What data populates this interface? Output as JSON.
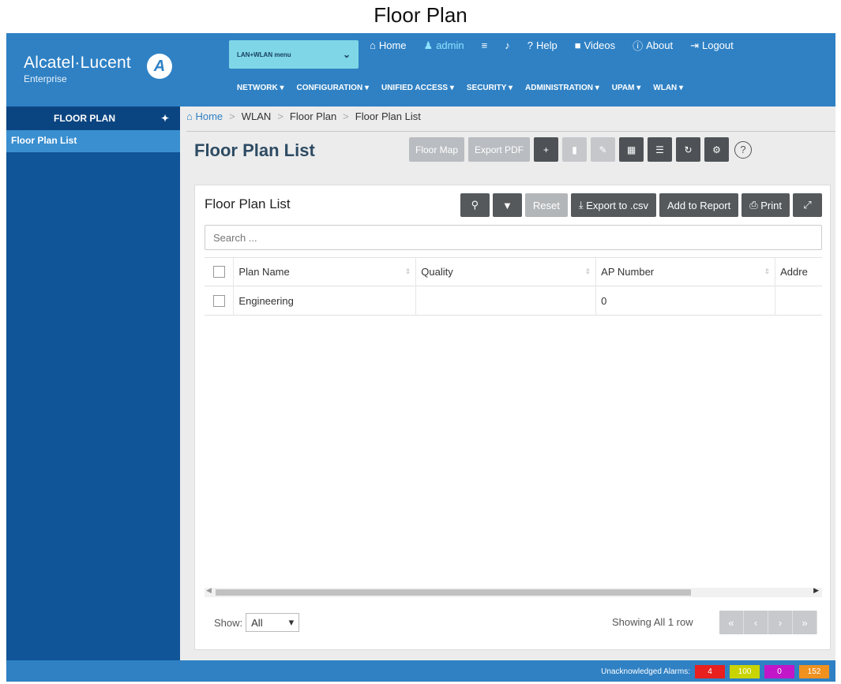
{
  "caption": "Floor Plan",
  "header": {
    "logo_main": "Alcatel·Lucent",
    "logo_sub": "Enterprise",
    "domain_select": "LAN+WLAN menu",
    "top_links": [
      {
        "icon": "home-icon",
        "glyph": "⌂",
        "label": "Home"
      },
      {
        "icon": "user-icon",
        "glyph": "♟",
        "label": "admin"
      },
      {
        "icon": "list-icon",
        "glyph": "≡",
        "label": ""
      },
      {
        "icon": "bell-icon",
        "glyph": "♪",
        "label": ""
      },
      {
        "icon": "help-icon",
        "glyph": "?",
        "label": "Help"
      },
      {
        "icon": "video-icon",
        "glyph": "■",
        "label": "Videos"
      },
      {
        "icon": "info-icon",
        "glyph": "ⓘ",
        "label": "About"
      },
      {
        "icon": "logout-icon",
        "glyph": "⇥",
        "label": "Logout"
      }
    ],
    "nav": [
      "NETWORK ▾",
      "CONFIGURATION ▾",
      "UNIFIED ACCESS ▾",
      "SECURITY ▾",
      "ADMINISTRATION ▾",
      "UPAM ▾",
      "WLAN ▾"
    ]
  },
  "sidebar": {
    "title": "FLOOR PLAN",
    "items": [
      "Floor Plan List"
    ]
  },
  "breadcrumb": [
    "Home",
    "WLAN",
    "Floor Plan",
    "Floor Plan List"
  ],
  "page": {
    "title": "Floor Plan List",
    "floor_map": "Floor Map",
    "export_pdf": "Export PDF"
  },
  "panel": {
    "title": "Floor Plan List",
    "reset": "Reset",
    "export_csv": "Export to .csv",
    "add_report": "Add to Report",
    "print": "Print",
    "search_placeholder": "Search ...",
    "columns": [
      "Plan Name",
      "Quality",
      "AP Number",
      "Addre"
    ],
    "rows": [
      {
        "plan_name": "Engineering",
        "quality": "",
        "ap_number": "0",
        "address": ""
      }
    ],
    "show_label": "Show:",
    "show_value": "All",
    "showing": "Showing All 1 row"
  },
  "footer": {
    "alarms_label": "Unacknowledged Alarms:",
    "alarms": [
      {
        "value": "4",
        "color": "#e8201f"
      },
      {
        "value": "100",
        "color": "#c9d400"
      },
      {
        "value": "0",
        "color": "#c216c9"
      },
      {
        "value": "152",
        "color": "#f09120"
      }
    ]
  },
  "colors": {
    "header": "#2f81c4",
    "sidebar": "#0f5597",
    "accent": "#7fd6e6"
  }
}
